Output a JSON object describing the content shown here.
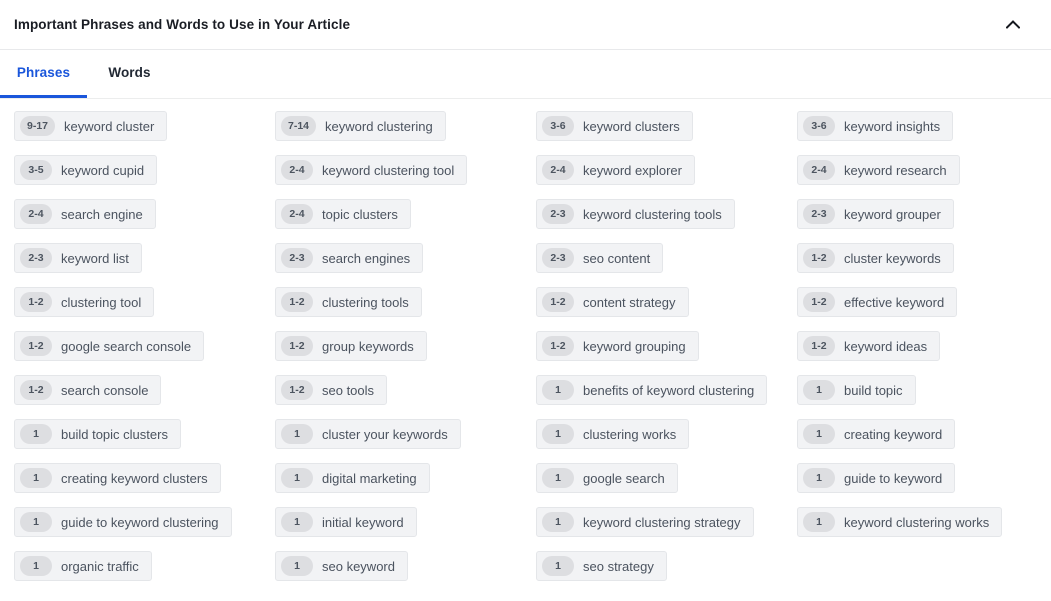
{
  "header": {
    "title": "Important Phrases and Words to Use in Your Article",
    "collapse_icon": "chevron-up-icon"
  },
  "tabs": [
    {
      "label": "Phrases",
      "active": true
    },
    {
      "label": "Words",
      "active": false
    }
  ],
  "colors": {
    "accent": "#1a56db",
    "chip_bg": "#f2f3f5",
    "chip_border": "#e4e6e9",
    "badge_bg": "#dddee1",
    "badge_text": "#4d5560",
    "chip_text": "#4b535f",
    "title_text": "#1a1d24"
  },
  "columns": [
    {
      "chips": [
        {
          "count": "9-17",
          "label": "keyword cluster"
        },
        {
          "count": "3-5",
          "label": "keyword cupid"
        },
        {
          "count": "2-4",
          "label": "search engine"
        },
        {
          "count": "2-3",
          "label": "keyword list"
        },
        {
          "count": "1-2",
          "label": "clustering tool"
        },
        {
          "count": "1-2",
          "label": "google search console"
        },
        {
          "count": "1-2",
          "label": "search console"
        },
        {
          "count": "1",
          "label": "build topic clusters"
        },
        {
          "count": "1",
          "label": "creating keyword clusters"
        },
        {
          "count": "1",
          "label": "guide to keyword clustering"
        },
        {
          "count": "1",
          "label": "organic traffic"
        }
      ]
    },
    {
      "chips": [
        {
          "count": "7-14",
          "label": "keyword clustering"
        },
        {
          "count": "2-4",
          "label": "keyword clustering tool"
        },
        {
          "count": "2-4",
          "label": "topic clusters"
        },
        {
          "count": "2-3",
          "label": "search engines"
        },
        {
          "count": "1-2",
          "label": "clustering tools"
        },
        {
          "count": "1-2",
          "label": "group keywords"
        },
        {
          "count": "1-2",
          "label": "seo tools"
        },
        {
          "count": "1",
          "label": "cluster your keywords"
        },
        {
          "count": "1",
          "label": "digital marketing"
        },
        {
          "count": "1",
          "label": "initial keyword"
        },
        {
          "count": "1",
          "label": "seo keyword"
        }
      ]
    },
    {
      "chips": [
        {
          "count": "3-6",
          "label": "keyword clusters"
        },
        {
          "count": "2-4",
          "label": "keyword explorer"
        },
        {
          "count": "2-3",
          "label": "keyword clustering tools"
        },
        {
          "count": "2-3",
          "label": "seo content"
        },
        {
          "count": "1-2",
          "label": "content strategy"
        },
        {
          "count": "1-2",
          "label": "keyword grouping"
        },
        {
          "count": "1",
          "label": "benefits of keyword clustering"
        },
        {
          "count": "1",
          "label": "clustering works"
        },
        {
          "count": "1",
          "label": "google search"
        },
        {
          "count": "1",
          "label": "keyword clustering strategy"
        },
        {
          "count": "1",
          "label": "seo strategy"
        }
      ]
    },
    {
      "chips": [
        {
          "count": "3-6",
          "label": "keyword insights"
        },
        {
          "count": "2-4",
          "label": "keyword research"
        },
        {
          "count": "2-3",
          "label": "keyword grouper"
        },
        {
          "count": "1-2",
          "label": "cluster keywords"
        },
        {
          "count": "1-2",
          "label": "effective keyword"
        },
        {
          "count": "1-2",
          "label": "keyword ideas"
        },
        {
          "count": "1",
          "label": "build topic"
        },
        {
          "count": "1",
          "label": "creating keyword"
        },
        {
          "count": "1",
          "label": "guide to keyword"
        },
        {
          "count": "1",
          "label": "keyword clustering works"
        }
      ]
    }
  ]
}
